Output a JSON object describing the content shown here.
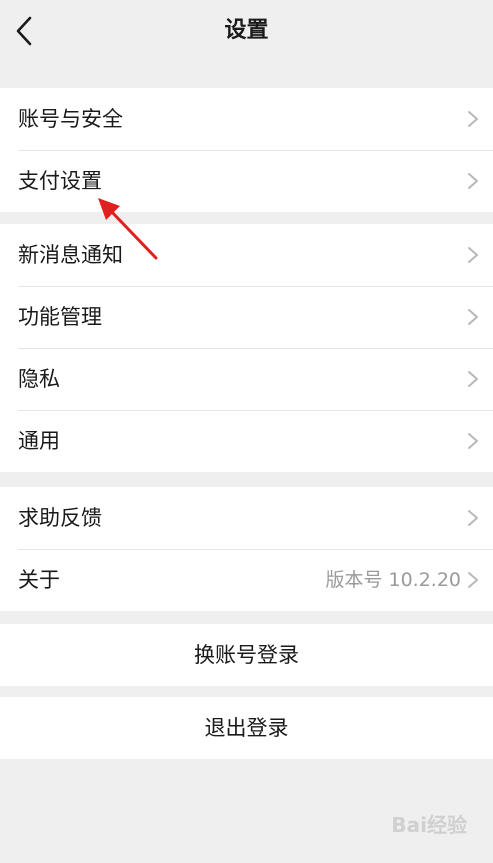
{
  "header": {
    "back_icon": "chevron-left-icon",
    "title": "设置"
  },
  "groups": [
    {
      "items": [
        {
          "label": "账号与安全"
        },
        {
          "label": "支付设置"
        }
      ]
    },
    {
      "items": [
        {
          "label": "新消息通知"
        },
        {
          "label": "功能管理"
        },
        {
          "label": "隐私"
        },
        {
          "label": "通用"
        }
      ]
    },
    {
      "items": [
        {
          "label": "求助反馈"
        },
        {
          "label": "关于",
          "value": "版本号 10.2.20"
        }
      ]
    }
  ],
  "actions": {
    "switch_account": "换账号登录",
    "logout": "退出登录"
  },
  "annotation": {
    "arrow_color": "#e0201e"
  },
  "watermark": {
    "text": "Bai经验"
  },
  "colors": {
    "background": "#efefef",
    "card": "#ffffff",
    "divider": "#e5e5e5",
    "secondary_text": "#9a9a9a"
  }
}
